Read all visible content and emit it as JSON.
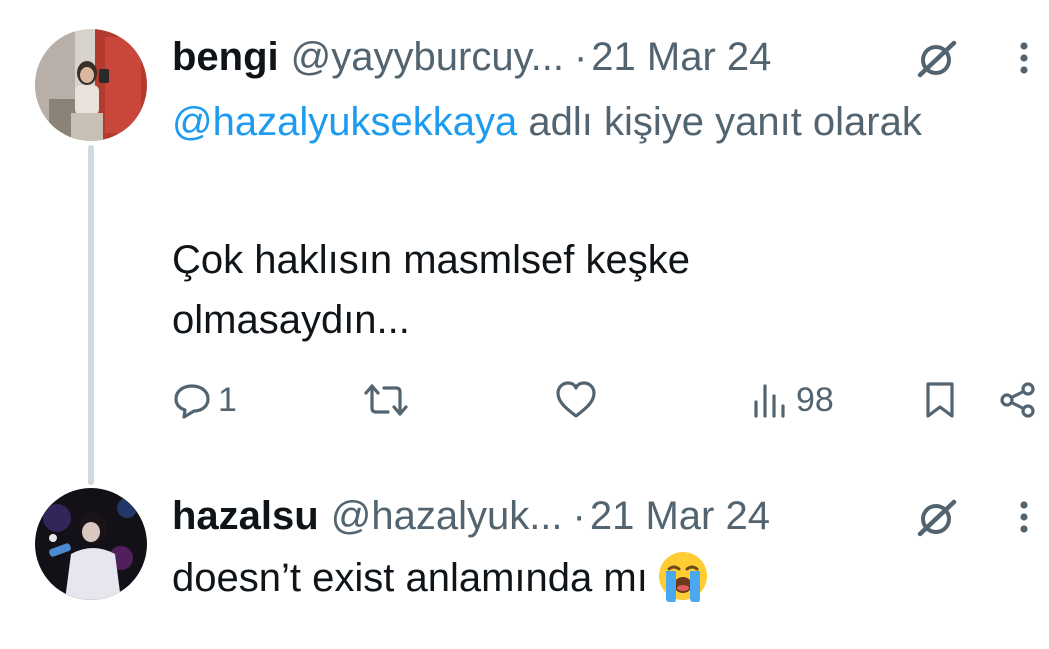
{
  "tweets": [
    {
      "author_name": "bengi",
      "handle": "@yayyburcuy...",
      "separator": "·",
      "date": "21 Mar 24",
      "reply_mention": "@hazalyuksekkaya",
      "reply_suffix": "adlı kişiye yanıt olarak",
      "text": "Çok haklısın masmlsef keşke olmasaydın...",
      "reply_count": "1",
      "views": "98"
    },
    {
      "author_name": "hazalsu",
      "handle": "@hazalyuk...",
      "separator": "·",
      "date": "21 Mar 24",
      "text": "doesn’t exist anlamında mı"
    }
  ],
  "icons": {
    "grok": "grok-icon",
    "more": "more-vertical-icon",
    "reply": "reply-icon",
    "retweet": "retweet-icon",
    "like": "heart-icon",
    "views": "views-bar-icon",
    "bookmark": "bookmark-icon",
    "share": "share-icon",
    "emoji": "loudly-crying-face-emoji"
  },
  "colors": {
    "mention": "#1d9bf0",
    "secondary_text": "#536471",
    "primary_text": "#0f1419",
    "thread_line": "#cfd9de"
  }
}
